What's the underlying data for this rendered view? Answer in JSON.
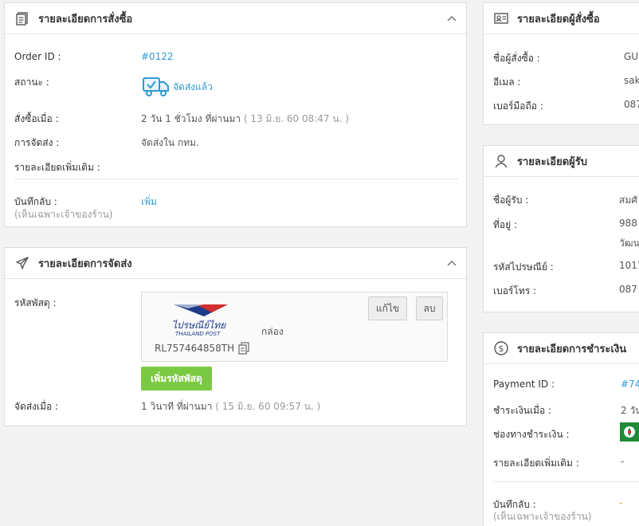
{
  "order_panel": {
    "title": "รายละเอียดการสั่งซื้อ",
    "order_id_label": "Order ID :",
    "order_id_value": "#0122",
    "status_label": "สถานะ :",
    "status_value": "จัดส่งแล้ว",
    "ordered_label": "สั่งซื้อเมื่อ :",
    "ordered_value": "2 วัน 1 ชั่วโมง ที่ผ่านมา",
    "ordered_date": "( 13 มิ.ย. 60 08:47 น. )",
    "delivery_label": "การจัดส่ง :",
    "delivery_value": "จัดส่งใน กทม.",
    "extra_label": "รายละเอียดเพิ่มเติม :",
    "note_label": "บันทึกลับ :",
    "note_sub": "(เห็นเฉพาะเจ้าของร้าน)",
    "note_add": "เพิ่ม"
  },
  "shipping_panel": {
    "title": "รายละเอียดการจัดส่ง",
    "tracking_label": "รหัสพัสดุ :",
    "carrier_logo_text": "ไปรษณีย์ไทย",
    "carrier_logo_sub": "THAILAND POST",
    "package_type": "กล่อง",
    "tracking_number": "RL757464858TH",
    "edit_button": "แก้ไข",
    "delete_button": "ลบ",
    "add_tracking_button": "เพิ่มรหัสพัสดุ",
    "shipped_label": "จัดส่งเมื่อ :",
    "shipped_value": "1 วินาที ที่ผ่านมา",
    "shipped_date": "( 15 มิ.ย. 60 09:57 น. )"
  },
  "buyer_panel": {
    "title": "รายละเอียดผู้สั่งซื้อ",
    "name_label": "ชื่อผู้สั่งซื้อ :",
    "name_value": "GU",
    "email_label": "อีเมล :",
    "email_value": "sak",
    "phone_label": "เบอร์มือถือ :",
    "phone_value": "087"
  },
  "recipient_panel": {
    "title": "รายละเอียดผู้รับ",
    "name_label": "ชื่อผู้รับ :",
    "name_value": "สมศั",
    "address_label": "ที่อยู่ :",
    "address_line1": "988",
    "address_line2": "วัฒน",
    "postal_label": "รหัสไปรษณีย์ :",
    "postal_value": "1017",
    "phone_label": "เบอร์โทร :",
    "phone_value": "087"
  },
  "payment_panel": {
    "title": "รายละเอียดการชำระเงิน",
    "payment_id_label": "Payment ID :",
    "payment_id_value": "#74",
    "paid_label": "ชำระเงินเมื่อ :",
    "paid_value": "2 วัน",
    "channel_label": "ช่องทางชำระเงิน :",
    "extra_label": "รายละเอียดเพิ่มเติม :",
    "extra_value": "-",
    "note_label": "บันทึกลับ :",
    "note_sub": "(เห็นเฉพาะเจ้าของร้าน)",
    "note_value": "-"
  },
  "colors": {
    "link": "#2e9ad6",
    "green_button": "#7ac943",
    "bank_green": "#1f8a3a"
  }
}
